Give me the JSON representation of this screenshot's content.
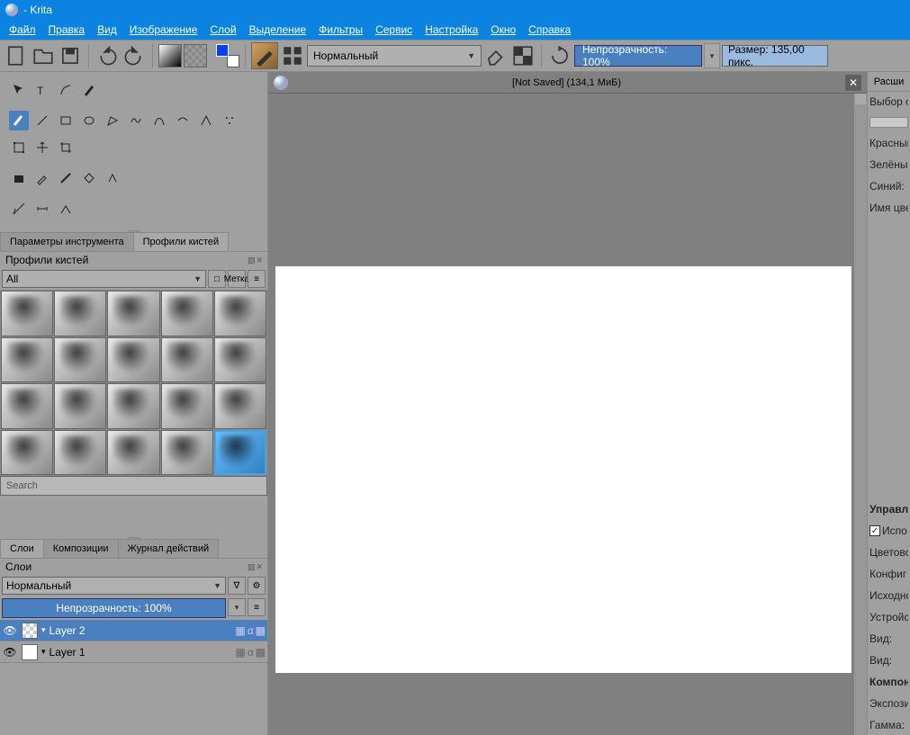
{
  "app": {
    "title": "- Krita"
  },
  "menu": [
    "Файл",
    "Правка",
    "Вид",
    "Изображение",
    "Слой",
    "Выделение",
    "Фильтры",
    "Сервис",
    "Настройка",
    "Окно",
    "Справка"
  ],
  "toolbar": {
    "blend_mode": "Нормальный",
    "opacity_label": "Непрозрачность: 100%",
    "size_label": "Размер: 135,00 пикс."
  },
  "doc": {
    "title": "[Not Saved]  (134,1 МиБ)"
  },
  "left_tabs": {
    "tool_options": "Параметры инструмента",
    "brush_presets": "Профили кистей"
  },
  "brush_panel": {
    "title": "Профили кистей",
    "filter_all": "All",
    "tag_label": "Метка",
    "search_placeholder": "Search"
  },
  "layer_tabs": {
    "layers": "Слои",
    "compositions": "Композиции",
    "history": "Журнал действий"
  },
  "layers": {
    "title": "Слои",
    "blend": "Нормальный",
    "opacity": "Непрозрачность:  100%",
    "items": [
      {
        "name": "Layer 2",
        "selected": true,
        "alpha": true
      },
      {
        "name": "Layer 1",
        "selected": false,
        "alpha": false
      }
    ]
  },
  "right": {
    "advanced_btn": "Расши",
    "color_selector": "Выбор о",
    "red": "Красный",
    "green": "Зелёный",
    "blue": "Синий:",
    "color_name": "Имя цве",
    "mgmt": "Управле",
    "use_env": "Испо",
    "colorspace": "Цветово",
    "config": "Конфиг",
    "source": "Исходно",
    "device": "Устройс",
    "view1": "Вид:",
    "view2": "Вид:",
    "components": "Компоне",
    "exposure": "Экспози",
    "gamma": "Гамма:"
  }
}
